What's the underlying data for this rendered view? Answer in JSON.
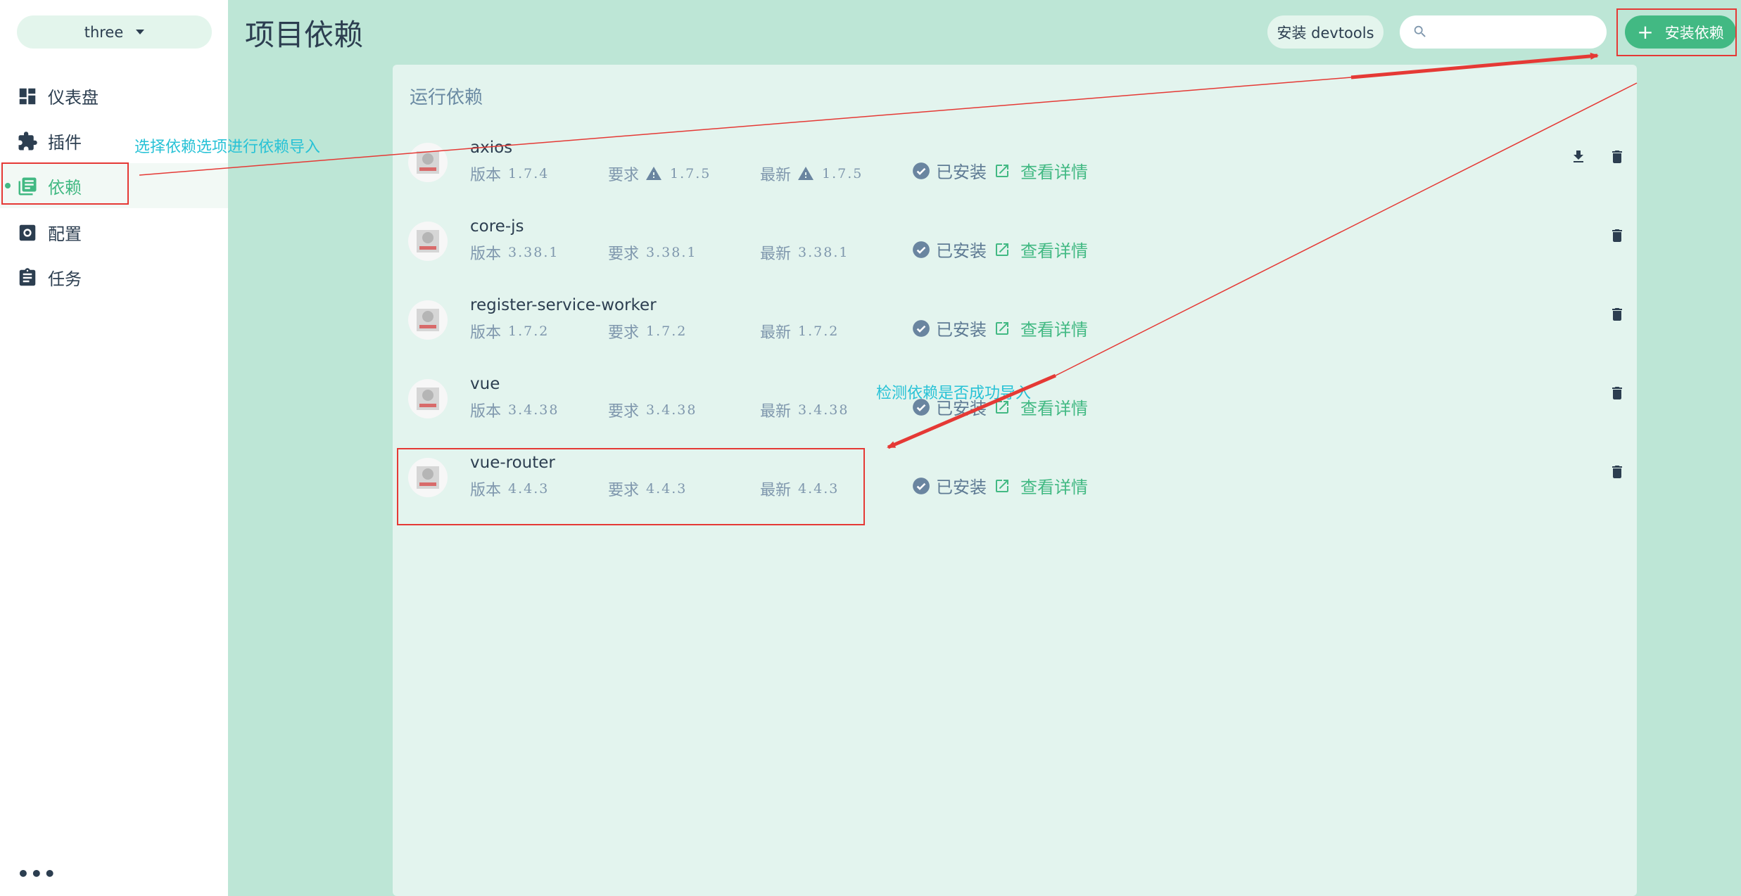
{
  "sidebar": {
    "project": "three",
    "items": [
      {
        "label": "仪表盘",
        "icon": "dashboard-icon"
      },
      {
        "label": "插件",
        "icon": "puzzle-icon"
      },
      {
        "label": "依赖",
        "icon": "library-books-icon"
      },
      {
        "label": "配置",
        "icon": "settings-icon"
      },
      {
        "label": "任务",
        "icon": "clipboard-icon"
      }
    ],
    "active_index": 2,
    "more_label": "•••"
  },
  "header": {
    "title": "项目依赖",
    "devtools_label": "安装 devtools",
    "search_placeholder": "",
    "install_label": "安装依赖"
  },
  "panel": {
    "title": "运行依赖",
    "labels": {
      "version": "版本",
      "required": "要求",
      "latest": "最新",
      "installed": "已安装",
      "details": "查看详情"
    },
    "dependencies": [
      {
        "name": "axios",
        "version": "1.7.4",
        "required": "1.7.5",
        "latest": "1.7.5",
        "outdated": true
      },
      {
        "name": "core-js",
        "version": "3.38.1",
        "required": "3.38.1",
        "latest": "3.38.1",
        "outdated": false
      },
      {
        "name": "register-service-worker",
        "version": "1.7.2",
        "required": "1.7.2",
        "latest": "1.7.2",
        "outdated": false
      },
      {
        "name": "vue",
        "version": "3.4.38",
        "required": "3.4.38",
        "latest": "3.4.38",
        "outdated": false
      },
      {
        "name": "vue-router",
        "version": "4.4.3",
        "required": "4.4.3",
        "latest": "4.4.3",
        "outdated": false
      }
    ]
  },
  "annotations": {
    "select_note": "选择依赖选项进行依赖导入",
    "check_note": "检测依赖是否成功导入",
    "color": "#e53935",
    "text_color": "#28c2d6"
  },
  "colors": {
    "accent": "#42b983",
    "background": "#bde6d6",
    "panel": "#e3f4ee",
    "text": "#2c3e50",
    "muted": "#7f97ad"
  }
}
